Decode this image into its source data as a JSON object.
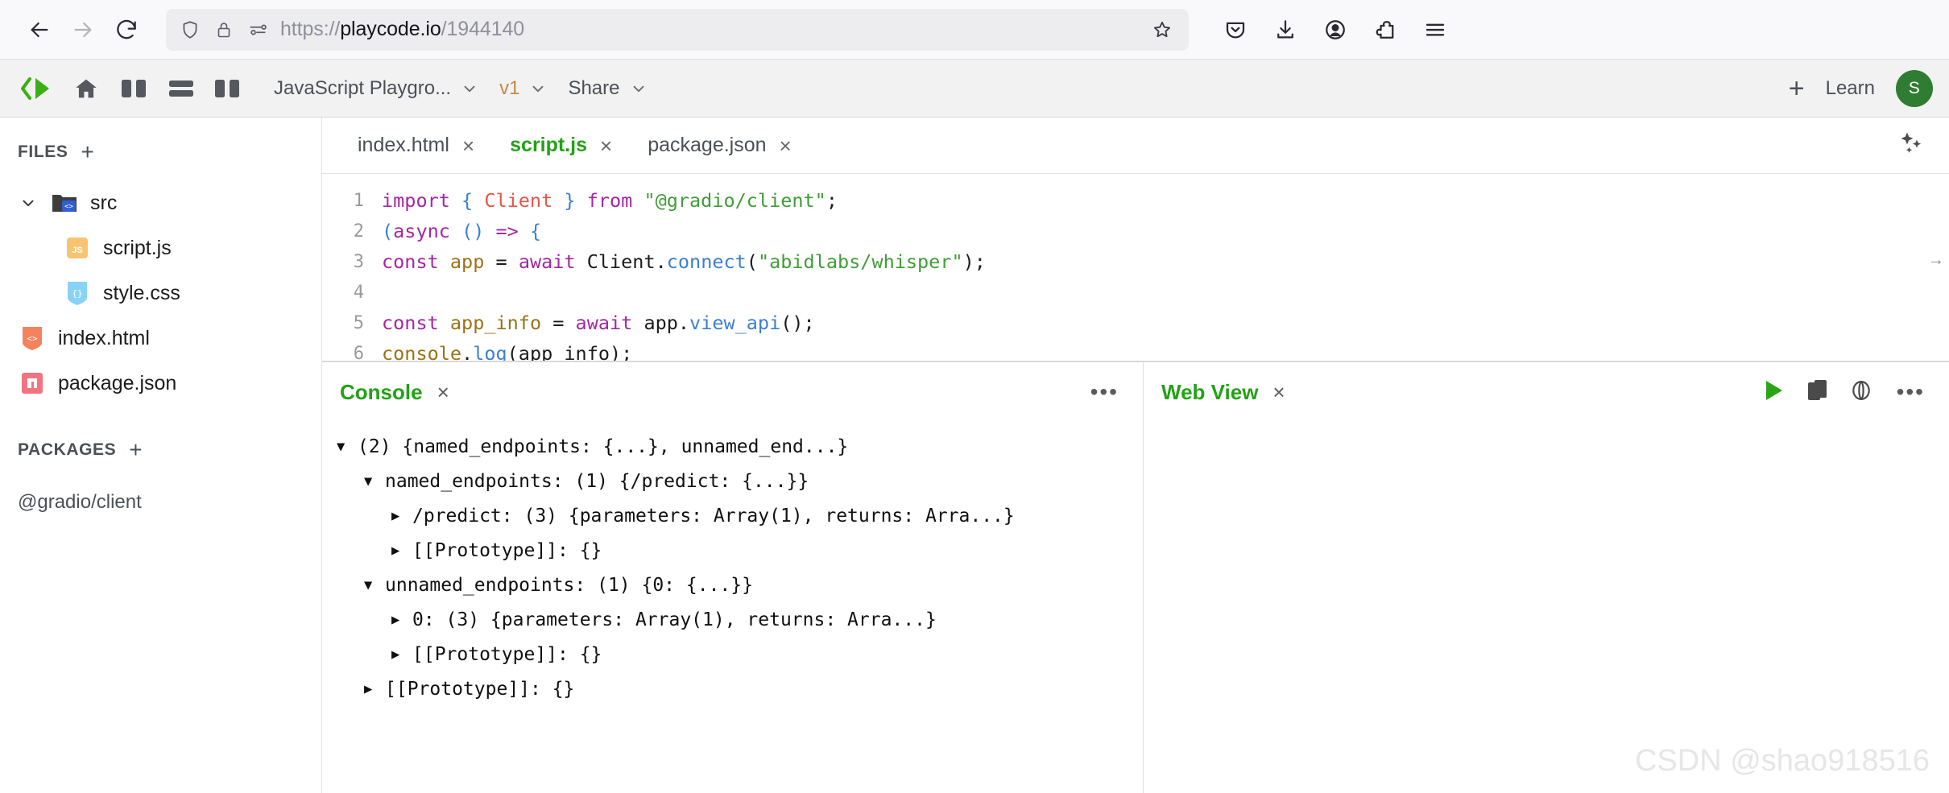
{
  "browser": {
    "back_label": "Back",
    "forward_label": "Forward",
    "reload_label": "Reload",
    "url_scheme": "https://",
    "url_host": "playcode.io",
    "url_path": "/1944140",
    "url_full": "https://playcode.io/1944140",
    "icons": {
      "shield": "shield-icon",
      "lock": "lock-icon",
      "permissions": "permissions-icon",
      "bookmark": "star-icon",
      "pocket": "pocket-icon",
      "downloads": "download-icon",
      "account": "account-icon",
      "extensions": "extensions-icon",
      "menu": "hamburger-menu-icon"
    }
  },
  "app_header": {
    "logo": "playcode-logo-icon",
    "home": "home-icon",
    "layout_left": "layout-split-left-icon",
    "layout_rows": "layout-rows-icon",
    "layout_right": "layout-split-right-icon",
    "project_name": "JavaScript Playgro...",
    "project_caret": "chevron-down-icon",
    "version_label": "v1",
    "version_caret": "chevron-down-icon",
    "share_label": "Share",
    "share_caret": "chevron-down-icon",
    "add_label": "+",
    "learn_label": "Learn",
    "avatar_initial": "S",
    "avatar_color": "#2f7d32"
  },
  "sidebar": {
    "files_title": "FILES",
    "files_add": "+",
    "packages_title": "PACKAGES",
    "packages_add": "+",
    "tree": [
      {
        "name": "src",
        "type": "folder",
        "icon": "folder-code-icon",
        "expanded": true,
        "indent": 0
      },
      {
        "name": "script.js",
        "type": "file",
        "icon": "js-file-icon",
        "indent": 1
      },
      {
        "name": "style.css",
        "type": "file",
        "icon": "css-file-icon",
        "indent": 1
      },
      {
        "name": "index.html",
        "type": "file",
        "icon": "html-file-icon",
        "indent": 0
      },
      {
        "name": "package.json",
        "type": "file",
        "icon": "npm-file-icon",
        "indent": 0
      }
    ],
    "packages": [
      "@gradio/client"
    ]
  },
  "editor": {
    "tabs": [
      {
        "label": "index.html",
        "active": false,
        "close": "×"
      },
      {
        "label": "script.js",
        "active": true,
        "close": "×"
      },
      {
        "label": "package.json",
        "active": false,
        "close": "×"
      }
    ],
    "ai_icon": "sparkles-icon",
    "active_color": "#22a216",
    "lines": [
      {
        "n": "1",
        "tokens": [
          {
            "t": "import ",
            "c": "k"
          },
          {
            "t": "{ ",
            "c": "br"
          },
          {
            "t": "Client",
            "c": "cls"
          },
          {
            "t": " }",
            "c": "br"
          },
          {
            "t": " ",
            "c": "pl"
          },
          {
            "t": "from",
            "c": "k"
          },
          {
            "t": " ",
            "c": "pl"
          },
          {
            "t": "\"@gradio/client\"",
            "c": "str"
          },
          {
            "t": ";",
            "c": "pl"
          }
        ]
      },
      {
        "n": "2",
        "tokens": [
          {
            "t": "(",
            "c": "br"
          },
          {
            "t": "async",
            "c": "k"
          },
          {
            "t": " ",
            "c": "pl"
          },
          {
            "t": "()",
            "c": "br"
          },
          {
            "t": " ",
            "c": "pl"
          },
          {
            "t": "=>",
            "c": "k"
          },
          {
            "t": " ",
            "c": "pl"
          },
          {
            "t": "{",
            "c": "br"
          }
        ]
      },
      {
        "n": "3",
        "tokens": [
          {
            "t": "const",
            "c": "k"
          },
          {
            "t": " ",
            "c": "pl"
          },
          {
            "t": "app",
            "c": "obj"
          },
          {
            "t": " = ",
            "c": "pl"
          },
          {
            "t": "await",
            "c": "k"
          },
          {
            "t": " Client.",
            "c": "pl"
          },
          {
            "t": "connect",
            "c": "fn"
          },
          {
            "t": "(",
            "c": "pl"
          },
          {
            "t": "\"abidlabs/whisper\"",
            "c": "str"
          },
          {
            "t": ");",
            "c": "pl"
          }
        ]
      },
      {
        "n": "4",
        "tokens": []
      },
      {
        "n": "5",
        "tokens": [
          {
            "t": "const",
            "c": "k"
          },
          {
            "t": " ",
            "c": "pl"
          },
          {
            "t": "app_info",
            "c": "obj"
          },
          {
            "t": " = ",
            "c": "pl"
          },
          {
            "t": "await",
            "c": "k"
          },
          {
            "t": " app.",
            "c": "pl"
          },
          {
            "t": "view_api",
            "c": "fn"
          },
          {
            "t": "();",
            "c": "pl"
          }
        ]
      },
      {
        "n": "6",
        "tokens": [
          {
            "t": "console",
            "c": "obj"
          },
          {
            "t": ".",
            "c": "pl"
          },
          {
            "t": "log",
            "c": "fn"
          },
          {
            "t": "(app_info);",
            "c": "pl"
          }
        ]
      }
    ]
  },
  "console_pane": {
    "title": "Console",
    "close": "×",
    "menu": "•••",
    "rows": [
      {
        "twisty": "▼",
        "indent": 0,
        "text": "(2) {named_endpoints: {...}, unnamed_end...}"
      },
      {
        "twisty": "▼",
        "indent": 1,
        "text": "named_endpoints: (1) {/predict: {...}}"
      },
      {
        "twisty": "▶",
        "indent": 2,
        "text": "/predict: (3) {parameters: Array(1), returns: Arra...}"
      },
      {
        "twisty": "▶",
        "indent": 2,
        "text": "[[Prototype]]: {}"
      },
      {
        "twisty": "▼",
        "indent": 1,
        "text": "unnamed_endpoints: (1) {0: {...}}"
      },
      {
        "twisty": "▶",
        "indent": 2,
        "text": "0: (3) {parameters: Array(1), returns: Arra...}"
      },
      {
        "twisty": "▶",
        "indent": 2,
        "text": "[[Prototype]]: {}"
      },
      {
        "twisty": "▶",
        "indent": 1,
        "text": "[[Prototype]]: {}"
      }
    ]
  },
  "webview_pane": {
    "title": "Web View",
    "close": "×",
    "run_icon": "play-icon",
    "device_icon": "device-preview-icon",
    "browser_icon": "open-in-browser-icon",
    "menu": "•••",
    "watermark": "CSDN @shao918516"
  }
}
